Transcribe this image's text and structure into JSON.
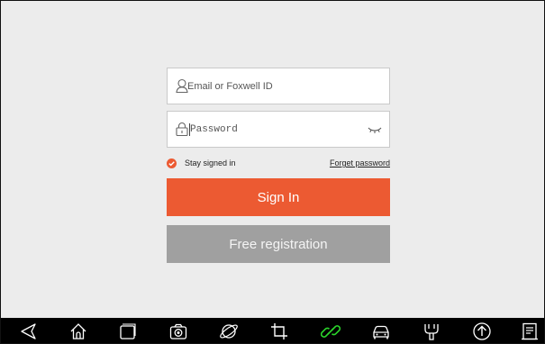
{
  "login": {
    "email_placeholder": "Email or Foxwell ID",
    "password_placeholder": "Password",
    "stay_signed_in_label": "Stay signed in",
    "stay_signed_in_checked": true,
    "forget_password_label": "Forget password",
    "sign_in_label": "Sign In",
    "free_registration_label": "Free registration"
  },
  "colors": {
    "accent": "#ec5a32",
    "secondary_button": "#a0a0a0",
    "background": "#ececec",
    "nav_bar": "#000000",
    "active_nav_icon": "#2bd62b"
  },
  "navbar": {
    "icons": [
      "back-icon",
      "home-icon",
      "recent-apps-icon",
      "camera-icon",
      "browser-icon",
      "crop-icon",
      "link-icon",
      "car-icon",
      "vci-connector-icon",
      "upload-icon",
      "report-icon"
    ]
  }
}
